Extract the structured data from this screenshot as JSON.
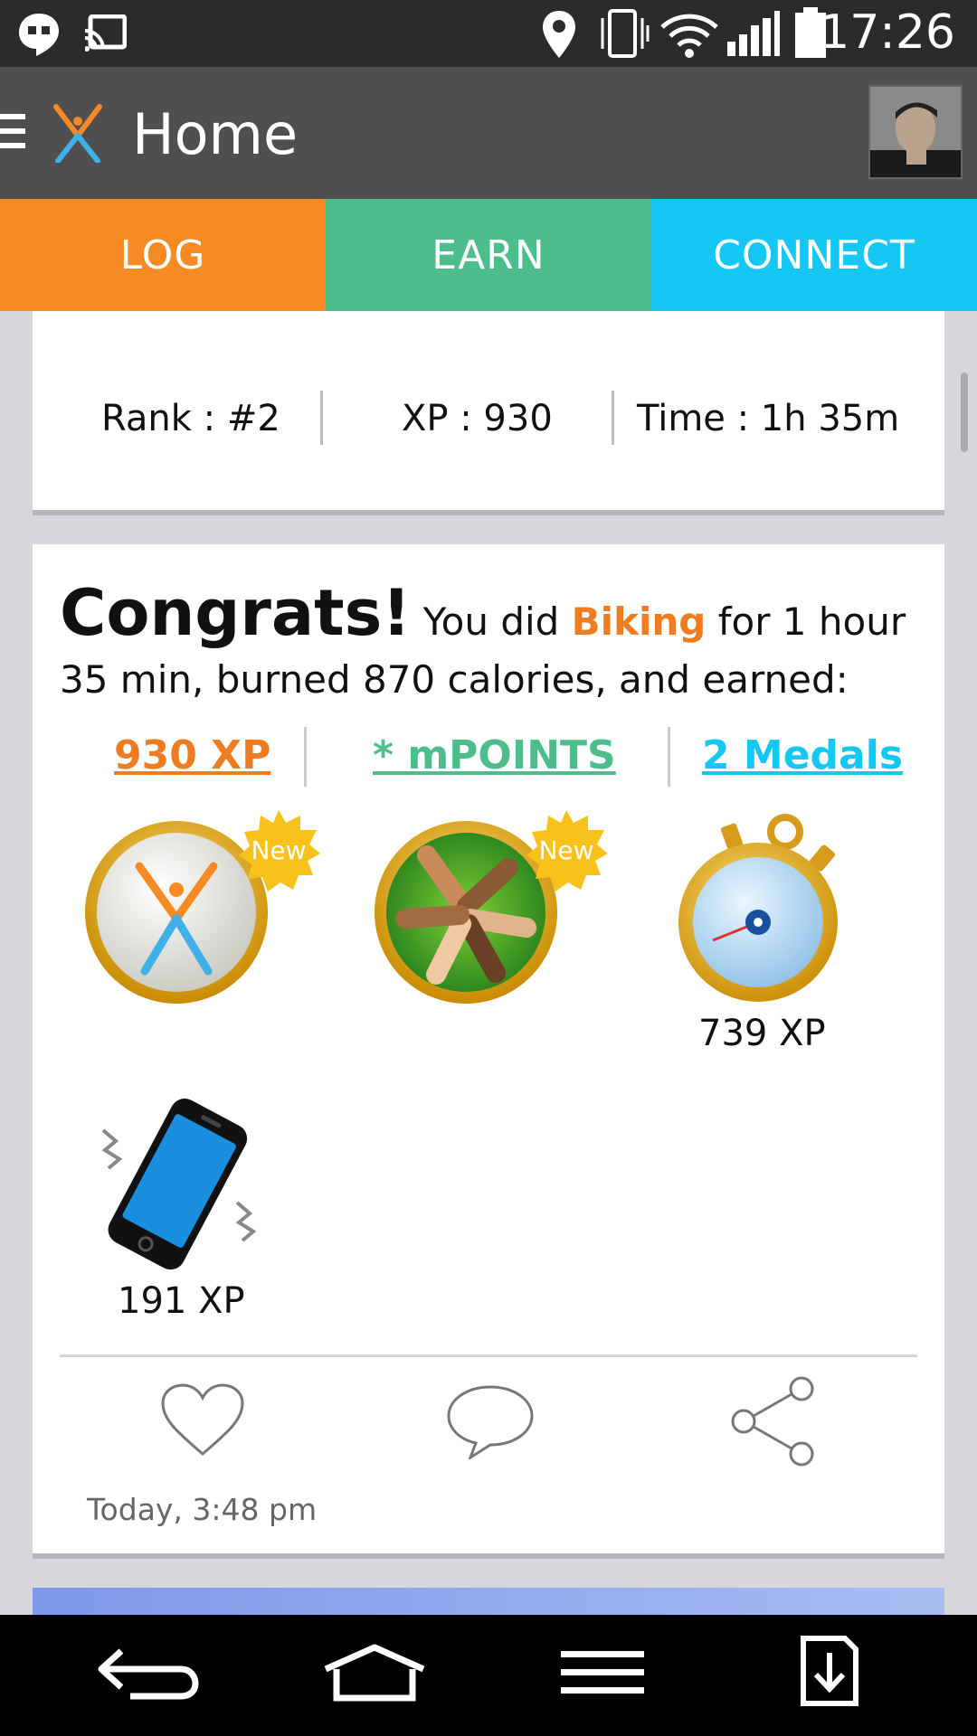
{
  "status_bar": {
    "time": "17:26",
    "icons": [
      "hangouts-icon",
      "cast-icon",
      "location-icon",
      "vibrate-icon",
      "wifi-icon",
      "signal-icon",
      "battery-icon"
    ]
  },
  "app_bar": {
    "title": "Home",
    "menu_icon": "hamburger-icon",
    "logo_icon": "x-person-logo-icon"
  },
  "tabs": [
    {
      "label": "LOG",
      "color": "#f68b25"
    },
    {
      "label": "EARN",
      "color": "#4dbd8b"
    },
    {
      "label": "CONNECT",
      "color": "#14c8f3"
    }
  ],
  "summary": {
    "rank": "Rank : #2",
    "xp": "XP : 930",
    "time": "Time : 1h 35m"
  },
  "activity": {
    "congrats": "Congrats!",
    "text_before": " You did ",
    "activity_name": "Biking",
    "text_after": " for 1 hour 35 min, burned 870 calories, and earned:",
    "earned_xp": "930 XP",
    "earned_points": "* mPOINTS",
    "earned_medals": "2 Medals",
    "new_label": "New",
    "badges": [
      {
        "icon": "x-person-badge-icon",
        "is_new": true
      },
      {
        "icon": "joined-hands-badge-icon",
        "is_new": true
      },
      {
        "icon": "stopwatch-medal-icon",
        "xp": "739 XP"
      },
      {
        "icon": "vibrating-phone-medal-icon",
        "xp": "191 XP"
      }
    ],
    "actions": [
      "like-icon",
      "comment-icon",
      "share-icon"
    ],
    "timestamp": "Today, 3:48 pm"
  },
  "nav_bar": [
    "back-icon",
    "home-icon",
    "menu-icon",
    "download-icon"
  ],
  "colors": {
    "orange": "#f07c22",
    "green": "#4dbd8b",
    "cyan": "#14c8f3"
  }
}
